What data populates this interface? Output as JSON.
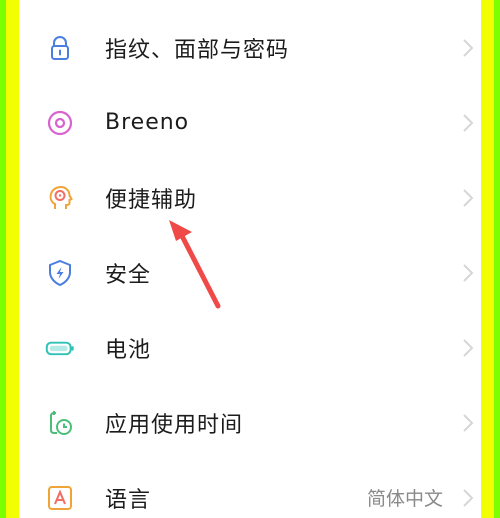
{
  "settings": {
    "items": [
      {
        "label": "指纹、面部与密码",
        "icon": "lock-icon",
        "color": "#4a7fe0"
      },
      {
        "label": "Breeno",
        "icon": "breeno-icon",
        "color": "#d862d0"
      },
      {
        "label": "便捷辅助",
        "icon": "assist-head-icon",
        "color": "#f0a437"
      },
      {
        "label": "安全",
        "icon": "shield-icon",
        "color": "#4a7fe0"
      },
      {
        "label": "电池",
        "icon": "battery-icon",
        "color": "#2ec2b7"
      },
      {
        "label": "应用使用时间",
        "icon": "app-time-icon",
        "color": "#4bbf7a"
      },
      {
        "label": "语言",
        "icon": "language-icon",
        "color": "#f0a437",
        "value": "简体中文"
      }
    ]
  },
  "annotation": {
    "icon": "red-arrow-icon",
    "color": "#f04a48"
  }
}
